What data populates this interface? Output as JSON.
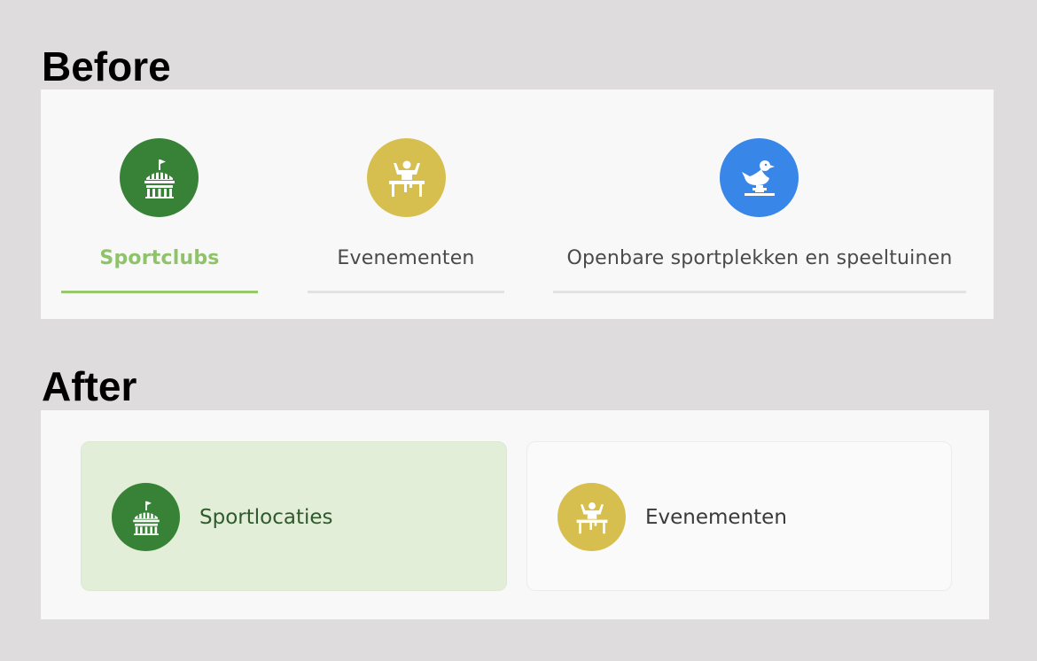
{
  "before": {
    "heading": "Before",
    "tabs": [
      {
        "label": "Sportclubs",
        "icon": "stadium-icon",
        "color": "#378236",
        "active": true
      },
      {
        "label": "Evenementen",
        "icon": "athlete-podium-icon",
        "color": "#d7bf4f",
        "active": false
      },
      {
        "label": "Openbare sportplekken en speeltuinen",
        "icon": "spring-rider-duck-icon",
        "color": "#3886e8",
        "active": false
      }
    ],
    "active_color": "#8fc36a"
  },
  "after": {
    "heading": "After",
    "cards": [
      {
        "label": "Sportlocaties",
        "icon": "stadium-icon",
        "color": "#378236",
        "selected": true,
        "background": "#e3eed8"
      },
      {
        "label": "Evenementen",
        "icon": "athlete-podium-icon",
        "color": "#d7bf4f",
        "selected": false,
        "background": "#fafafa"
      }
    ]
  }
}
